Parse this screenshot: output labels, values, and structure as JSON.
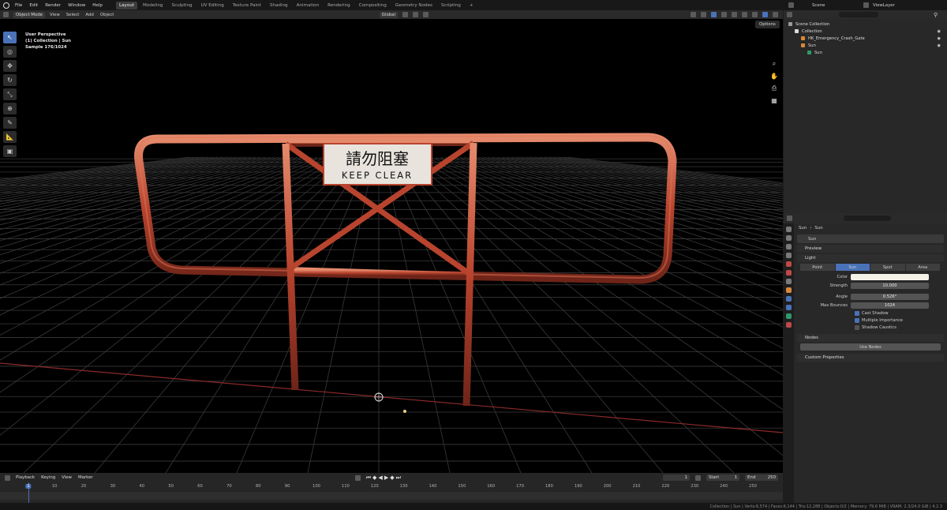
{
  "menu": [
    "File",
    "Edit",
    "Render",
    "Window",
    "Help"
  ],
  "workspaces": [
    {
      "label": "Layout",
      "active": true
    },
    {
      "label": "Modeling"
    },
    {
      "label": "Sculpting"
    },
    {
      "label": "UV Editing"
    },
    {
      "label": "Texture Paint"
    },
    {
      "label": "Shading"
    },
    {
      "label": "Animation"
    },
    {
      "label": "Rendering"
    },
    {
      "label": "Compositing"
    },
    {
      "label": "Geometry Nodes"
    },
    {
      "label": "Scripting"
    },
    {
      "label": "+"
    }
  ],
  "scene": {
    "label": "Scene",
    "view_layer": "ViewLayer"
  },
  "viewport_header": {
    "mode": "Object Mode",
    "menus": [
      "View",
      "Select",
      "Add",
      "Object"
    ],
    "transform": "Global",
    "options": "Options"
  },
  "viewport_info": {
    "line1": "User Perspective",
    "line2": "(1) Collection | Sun",
    "line3": "Sample 176/1024"
  },
  "sign": {
    "line1": "請勿阻塞",
    "line2": "KEEP CLEAR"
  },
  "outliner": {
    "rows": [
      {
        "label": "Scene Collection",
        "indent": 0
      },
      {
        "label": "Collection",
        "indent": 1
      },
      {
        "label": "HK_Emergency_Crash_Gate",
        "indent": 2
      },
      {
        "label": "Sun",
        "indent": 2
      },
      {
        "label": "Sun",
        "indent": 3
      }
    ]
  },
  "properties": {
    "breadcrumb": [
      "Sun",
      "Sun"
    ],
    "datablock": "Sun",
    "panels": {
      "preview": "Preview",
      "light": "Light",
      "nodes": "Nodes",
      "custom": "Custom Properties"
    },
    "light_types": [
      {
        "label": "Point"
      },
      {
        "label": "Sun",
        "active": true
      },
      {
        "label": "Spot"
      },
      {
        "label": "Area"
      }
    ],
    "fields": [
      {
        "label": "Color",
        "value": "",
        "kind": "color"
      },
      {
        "label": "Strength",
        "value": "10.000"
      },
      {
        "label": "Angle",
        "value": "0.526°"
      },
      {
        "label": "Max Bounces",
        "value": "1024"
      }
    ],
    "checkboxes": [
      {
        "label": "Cast Shadow",
        "checked": true
      },
      {
        "label": "Multiple Importance",
        "checked": true
      },
      {
        "label": "Shadow Caustics",
        "checked": false
      }
    ],
    "use_nodes": "Use Nodes"
  },
  "timeline": {
    "menus": [
      "Playback",
      "Keying",
      "View",
      "Marker"
    ],
    "current_frame": "1",
    "start_label": "Start",
    "start": "1",
    "end_label": "End",
    "end": "250",
    "ticks": [
      "1",
      "10",
      "20",
      "30",
      "40",
      "50",
      "60",
      "70",
      "80",
      "90",
      "100",
      "110",
      "120",
      "130",
      "140",
      "150",
      "160",
      "170",
      "180",
      "190",
      "200",
      "210",
      "220",
      "230",
      "240",
      "250"
    ]
  },
  "statusbar": "Collection | Sun | Verts:6,574 | Faces:6,144 | Tris:12,288 | Objects:0/2 | Memory: 79.6 MiB | VRAM: 2.3/24.0 GiB | 4.2.3",
  "colors": {
    "accent": "#4a72b8",
    "rail": "#b8442e",
    "rail_light": "#e0755a",
    "grid": "#3a3a3a",
    "x_axis": "#8b2a2a"
  }
}
